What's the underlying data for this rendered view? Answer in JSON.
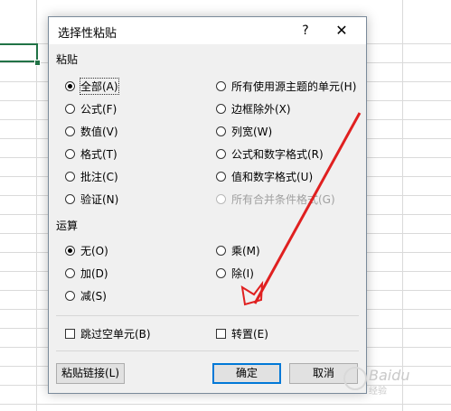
{
  "dialog": {
    "title": "选择性粘贴",
    "help": "?",
    "close": "✕"
  },
  "paste": {
    "label": "粘贴",
    "left": [
      {
        "label": "全部(A)",
        "selected": true
      },
      {
        "label": "公式(F)",
        "selected": false
      },
      {
        "label": "数值(V)",
        "selected": false
      },
      {
        "label": "格式(T)",
        "selected": false
      },
      {
        "label": "批注(C)",
        "selected": false
      },
      {
        "label": "验证(N)",
        "selected": false
      }
    ],
    "right": [
      {
        "label": "所有使用源主题的单元(H)",
        "selected": false
      },
      {
        "label": "边框除外(X)",
        "selected": false
      },
      {
        "label": "列宽(W)",
        "selected": false
      },
      {
        "label": "公式和数字格式(R)",
        "selected": false
      },
      {
        "label": "值和数字格式(U)",
        "selected": false
      },
      {
        "label": "所有合并条件格式(G)",
        "selected": false,
        "disabled": true
      }
    ]
  },
  "operation": {
    "label": "运算",
    "left": [
      {
        "label": "无(O)",
        "selected": true
      },
      {
        "label": "加(D)",
        "selected": false
      },
      {
        "label": "减(S)",
        "selected": false
      }
    ],
    "right": [
      {
        "label": "乘(M)",
        "selected": false
      },
      {
        "label": "除(I)",
        "selected": false
      }
    ]
  },
  "checks": {
    "skip_blanks": {
      "label": "跳过空单元(B)",
      "checked": false
    },
    "transpose": {
      "label": "转置(E)",
      "checked": false
    }
  },
  "buttons": {
    "paste_link": "粘贴链接(L)",
    "ok": "确定",
    "cancel": "取消"
  },
  "watermark": {
    "text": "Baidu",
    "sub": "经验"
  },
  "colors": {
    "arrow": "#e02020",
    "accent": "#0078d7",
    "cell_selection": "#217346"
  }
}
